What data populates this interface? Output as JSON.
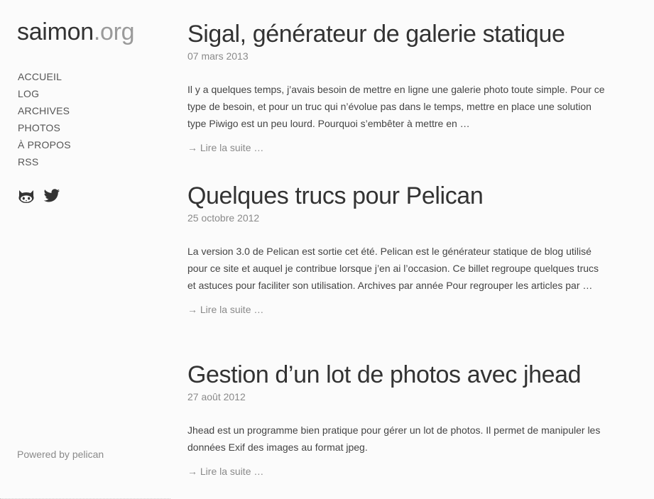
{
  "site": {
    "name": "saimon",
    "tld": ".org"
  },
  "nav": {
    "items": [
      {
        "label": "ACCUEIL"
      },
      {
        "label": "LOG"
      },
      {
        "label": "ARCHIVES"
      },
      {
        "label": "PHOTOS"
      },
      {
        "label": "À PROPOS"
      },
      {
        "label": "RSS"
      }
    ]
  },
  "social": {
    "icons": [
      "github-icon",
      "twitter-icon"
    ],
    "color": "#333333"
  },
  "footer": {
    "powered_prefix": "Powered by ",
    "powered_link": "pelican"
  },
  "articles": [
    {
      "title": "Sigal, générateur de galerie statique",
      "date": "07 mars 2013",
      "summary": "Il y a quelques temps, j’avais besoin de mettre en ligne une galerie photo toute simple. Pour ce type de besoin, et pour un truc qui n’évolue pas dans le temps, mettre en place une solution type Piwigo est un peu lourd. Pourquoi s’embêter à mettre en …",
      "more": "→ Lire la suite …"
    },
    {
      "title": "Quelques trucs pour Pelican",
      "date": "25 octobre 2012",
      "summary": "La version 3.0 de Pelican est sortie cet été. Pelican est le générateur statique de blog utilisé pour ce site et auquel je contribue lorsque j’en ai l’occasion. Ce billet regroupe quelques trucs et astuces pour faciliter son utilisation. Archives par année Pour regrouper les articles par …",
      "more": "→ Lire la suite …"
    },
    {
      "title": "Gestion d’un lot de photos avec jhead",
      "date": "27 août 2012",
      "summary": "Jhead est un programme bien pratique pour gérer un lot de photos. Il permet de manipuler les données Exif des images au format jpeg.",
      "more": "→ Lire la suite …"
    }
  ]
}
